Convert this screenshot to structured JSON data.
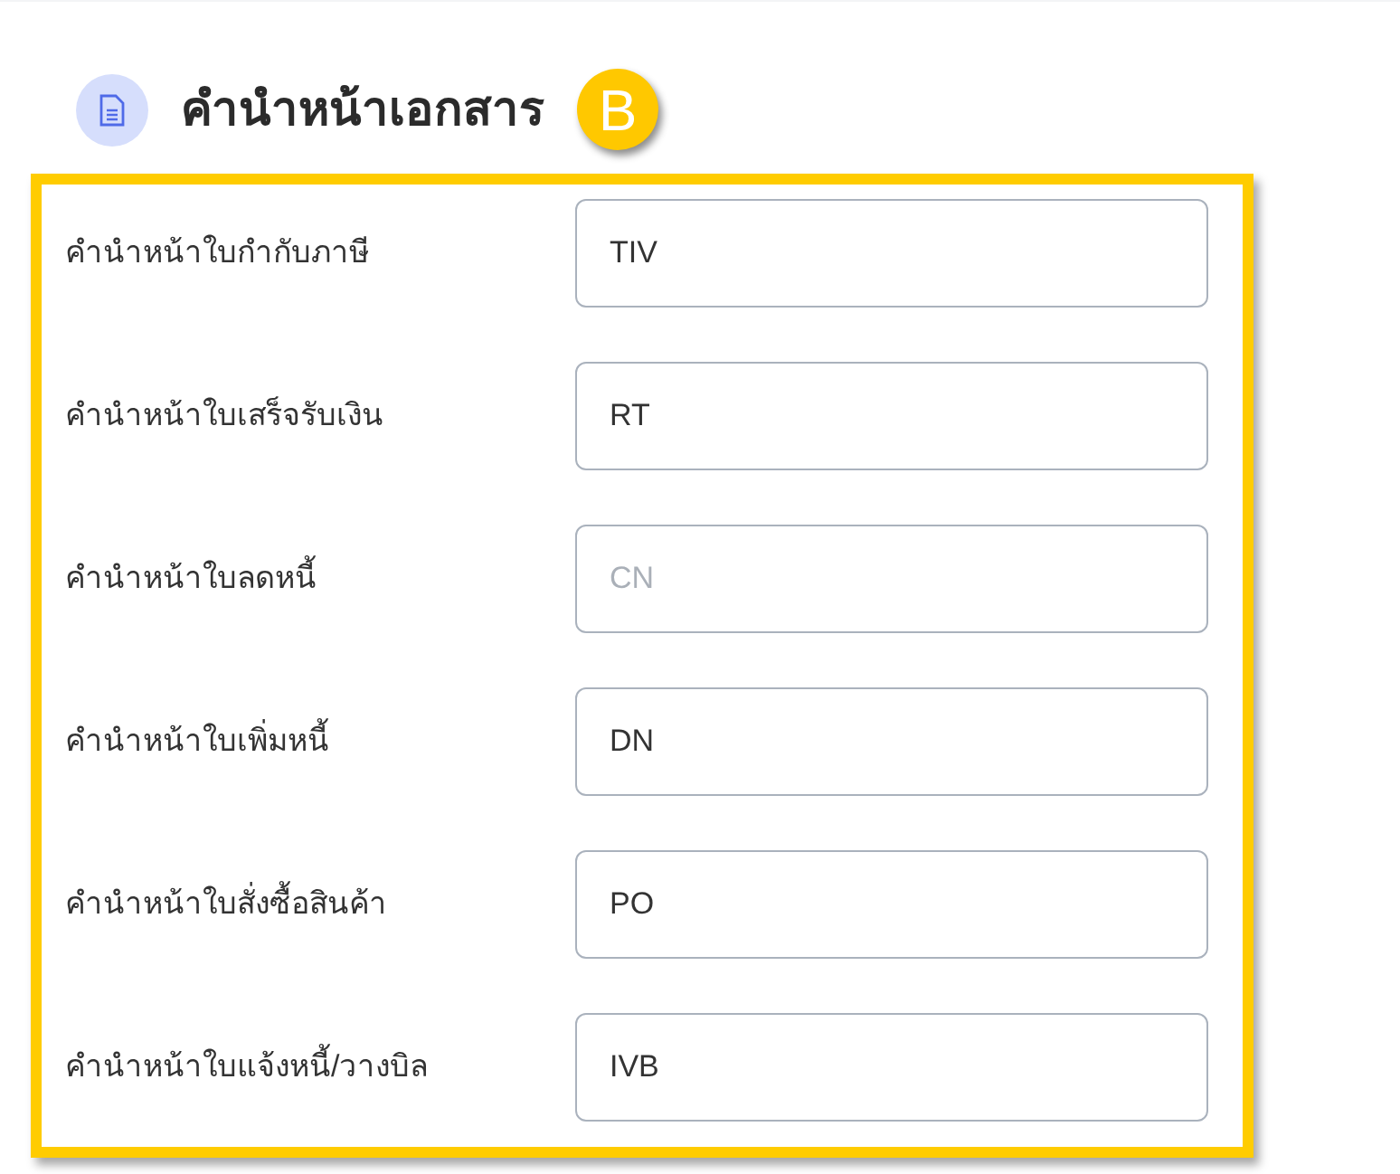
{
  "section": {
    "title": "คำนำหน้าเอกสาร",
    "badge": "B"
  },
  "fields": [
    {
      "label": "คำนำหน้าใบกำกับภาษี",
      "value": "TIV"
    },
    {
      "label": "คำนำหน้าใบเสร็จรับเงิน",
      "value": "RT"
    },
    {
      "label": "คำนำหน้าใบลดหนี้",
      "placeholder": "CN"
    },
    {
      "label": "คำนำหน้าใบเพิ่มหนี้",
      "value": "DN"
    },
    {
      "label": "คำนำหน้าใบสั่งซื้อสินค้า",
      "value": "PO"
    },
    {
      "label": "คำนำหน้าใบแจ้งหนี้/วางบิล",
      "value": "IVB"
    }
  ]
}
